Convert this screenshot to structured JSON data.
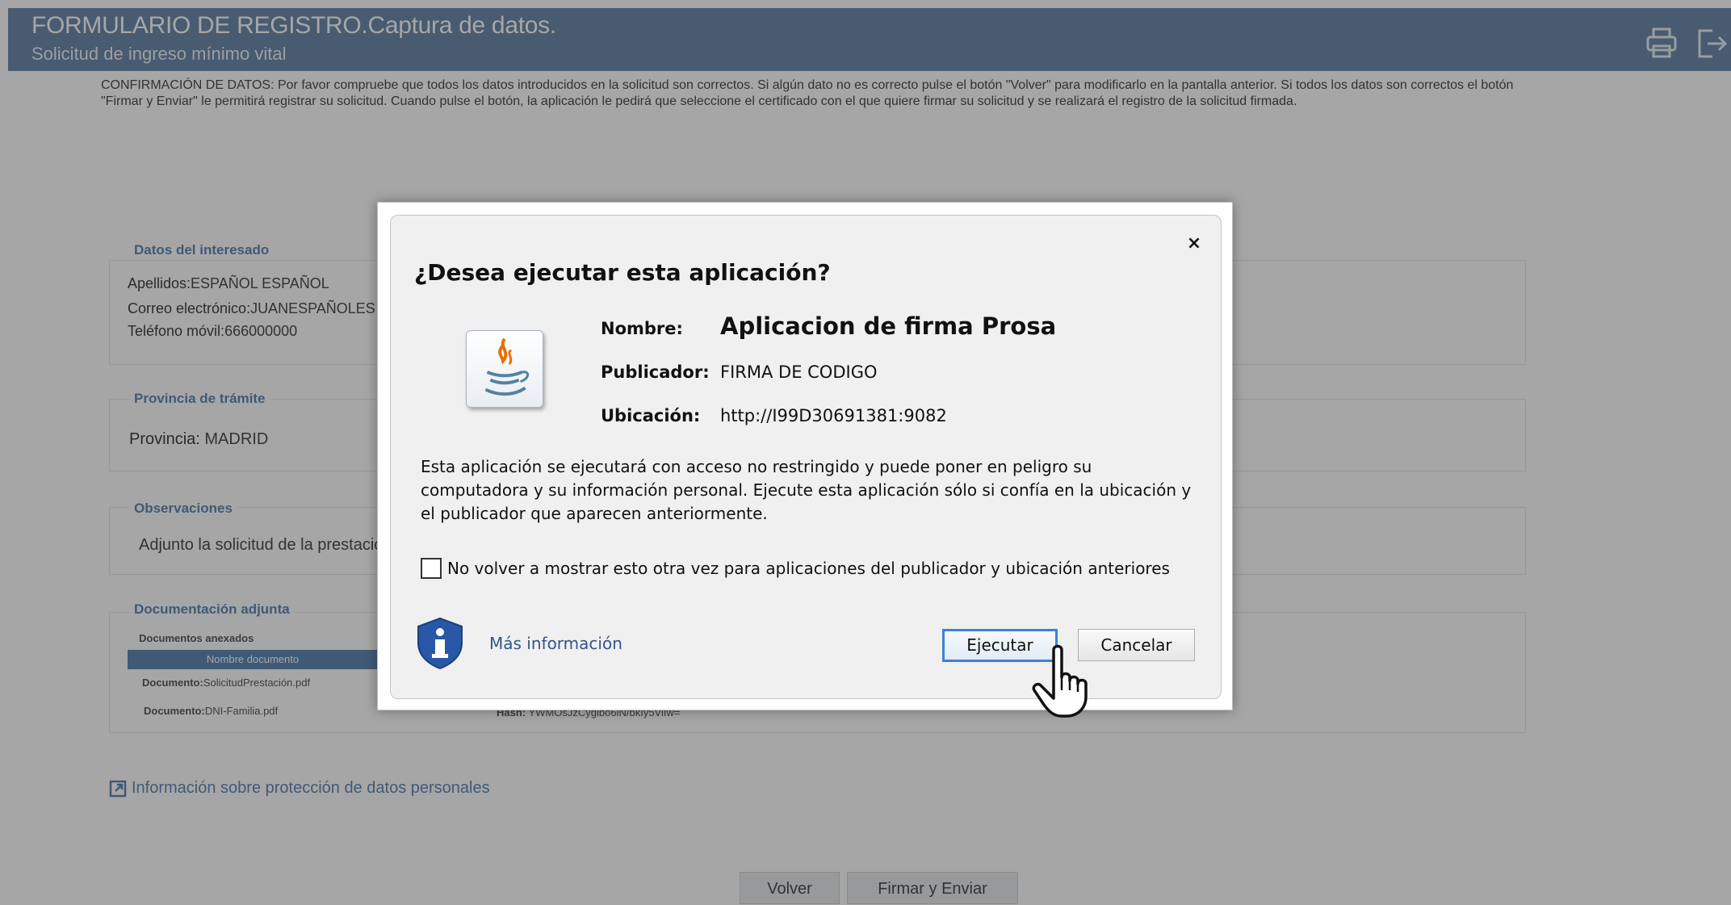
{
  "header": {
    "title": "FORMULARIO DE REGISTRO.Captura de datos.",
    "subtitle": "Solicitud de ingreso mínimo vital",
    "print_icon": "printer-icon",
    "exit_icon": "logout-icon",
    "color": "#4b6f97"
  },
  "confirmation_note": "CONFIRMACIÓN DE DATOS: Por favor compruebe que todos los datos introducidos en la solicitud son correctos. Si algún dato no es correcto pulse el botón \"Volver\" para modificarlo en la pantalla anterior. Si todos los datos son correctos el botón \"Firmar y Enviar\" le permitirá registrar su solicitud. Cuando pulse el botón, la aplicación le pedirá que seleccione el certificado con el que quiere firmar su solicitud y se realizará el registro de la solicitud firmada.",
  "sections": {
    "interesado": {
      "title": "Datos del interesado",
      "apellidos_label": "Apellidos:",
      "apellidos_value": "ESPAÑOL ESPAÑOL",
      "correo_label": "Correo electrónico:",
      "correo_value": "JUANESPAÑOLES",
      "telefono_label": "Teléfono móvil:",
      "telefono_value": "666000000"
    },
    "provincia": {
      "title": "Provincia de trámite",
      "label": "Provincia:",
      "value": "MADRID"
    },
    "observaciones": {
      "title": "Observaciones",
      "value": "Adjunto la solicitud de la prestació"
    },
    "documentacion": {
      "title": "Documentación adjunta",
      "subtitle": "Documentos anexados",
      "column_header": "Nombre documento",
      "doc1_label": "Documento:",
      "doc1_value": "SolicitudPrestación.pdf",
      "doc2_label": "Documento:",
      "doc2_value": "DNI-Familia.pdf",
      "hash_label": "Hash:",
      "hash_value": "YWMOsJzCyglbo6iN/bkIy5ViIw="
    }
  },
  "privacy_link": "Información sobre protección de datos personales",
  "bottom_buttons": {
    "back": "Volver",
    "sign": "Firmar y Enviar"
  },
  "dialog": {
    "close": "×",
    "heading": "¿Desea ejecutar esta aplicación?",
    "app_icon": "java-icon",
    "name_label": "Nombre:",
    "name_value": "Aplicacion de firma Prosa",
    "publisher_label": "Publicador:",
    "publisher_value": "FIRMA DE CODIGO",
    "location_label": "Ubicación:",
    "location_value": "http://I99D30691381:9082",
    "warning": "Esta aplicación se ejecutará con acceso no restringido y puede poner en peligro su computadora y su información personal. Ejecute esta aplicación sólo si confía en la ubicación y el publicador que aparecen anteriormente.",
    "checkbox_label": "No volver a mostrar esto otra vez para aplicaciones del publicador y ubicación anteriores",
    "checkbox_checked": false,
    "more_info": "Más información",
    "run_button": "Ejecutar",
    "cancel_button": "Cancelar",
    "cursor_icon": "hand-pointer-icon"
  }
}
